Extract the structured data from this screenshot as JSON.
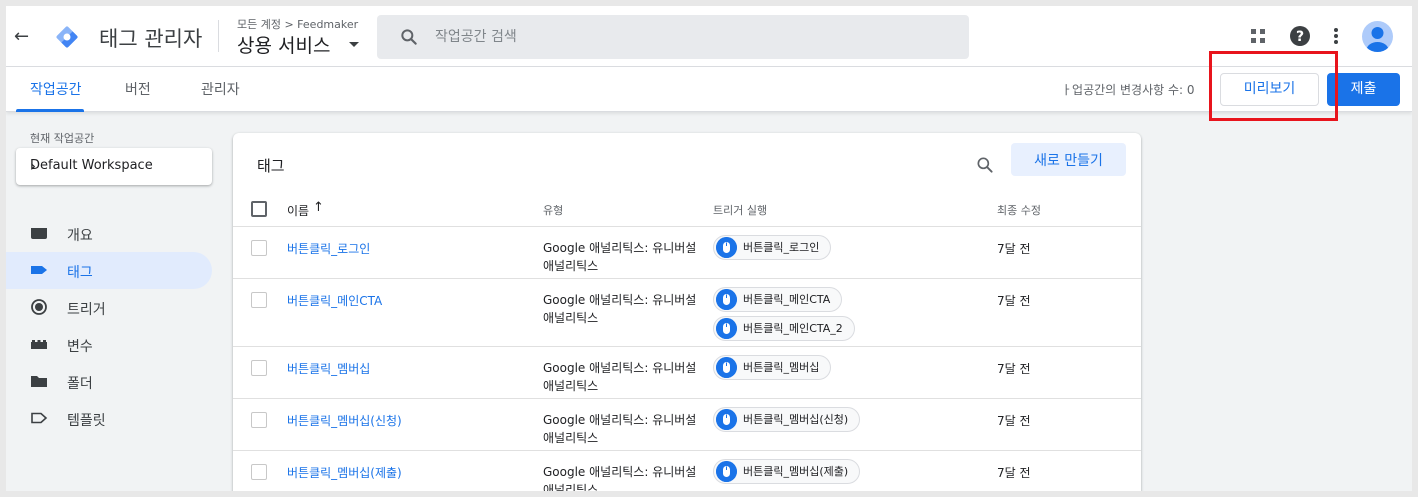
{
  "header": {
    "app_title": "태그 관리자",
    "breadcrumb": "모든 계정 > Feedmaker",
    "container_name": "상용 서비스",
    "search_placeholder": "작업공간 검색"
  },
  "tabs": [
    {
      "label": "작업공간",
      "active": true
    },
    {
      "label": "버전",
      "active": false
    },
    {
      "label": "관리자",
      "active": false
    }
  ],
  "toolbar": {
    "changes_text": "ㅏ업공간의 변경사항 수: 0",
    "preview_label": "미리보기",
    "submit_label": "제출"
  },
  "sidebar": {
    "workspace_label": "현재 작업공간",
    "workspace_name": "Default Workspace",
    "items": [
      {
        "label": "개요",
        "icon": "overview-icon",
        "active": false
      },
      {
        "label": "태그",
        "icon": "tag-icon",
        "active": true
      },
      {
        "label": "트리거",
        "icon": "trigger-icon",
        "active": false
      },
      {
        "label": "변수",
        "icon": "variables-icon",
        "active": false
      },
      {
        "label": "폴더",
        "icon": "folder-icon",
        "active": false
      },
      {
        "label": "템플릿",
        "icon": "template-icon",
        "active": false
      }
    ]
  },
  "tags_card": {
    "title": "태그",
    "new_label": "새로 만들기",
    "columns": {
      "name": "이름",
      "type": "유형",
      "trigger": "트리거 실행",
      "updated": "최종 수정"
    },
    "rows": [
      {
        "name": "버튼클릭_로그인",
        "type_line1": "Google 애널리틱스: 유니버설",
        "type_line2": "애널리틱스",
        "triggers": [
          "버튼클릭_로그인"
        ],
        "updated": "7달 전"
      },
      {
        "name": "버튼클릭_메인CTA",
        "type_line1": "Google 애널리틱스: 유니버설",
        "type_line2": "애널리틱스",
        "triggers": [
          "버튼클릭_메인CTA",
          "버튼클릭_메인CTA_2"
        ],
        "updated": "7달 전"
      },
      {
        "name": "버튼클릭_멤버십",
        "type_line1": "Google 애널리틱스: 유니버설",
        "type_line2": "애널리틱스",
        "triggers": [
          "버튼클릭_멤버십"
        ],
        "updated": "7달 전"
      },
      {
        "name": "버튼클릭_멤버십(신청)",
        "type_line1": "Google 애널리틱스: 유니버설",
        "type_line2": "애널리틱스",
        "triggers": [
          "버튼클릭_멤버십(신청)"
        ],
        "updated": "7달 전"
      },
      {
        "name": "버튼클릭_멤버십(제출)",
        "type_line1": "Google 애널리틱스: 유니버설",
        "type_line2": "애널리틱스",
        "triggers": [
          "버튼클릭_멤버십(제출)"
        ],
        "updated": "7달 전"
      }
    ]
  },
  "colors": {
    "accent": "#1a73e8",
    "highlight": "#e8141c",
    "active_nav_bg": "#e1ebfd"
  }
}
